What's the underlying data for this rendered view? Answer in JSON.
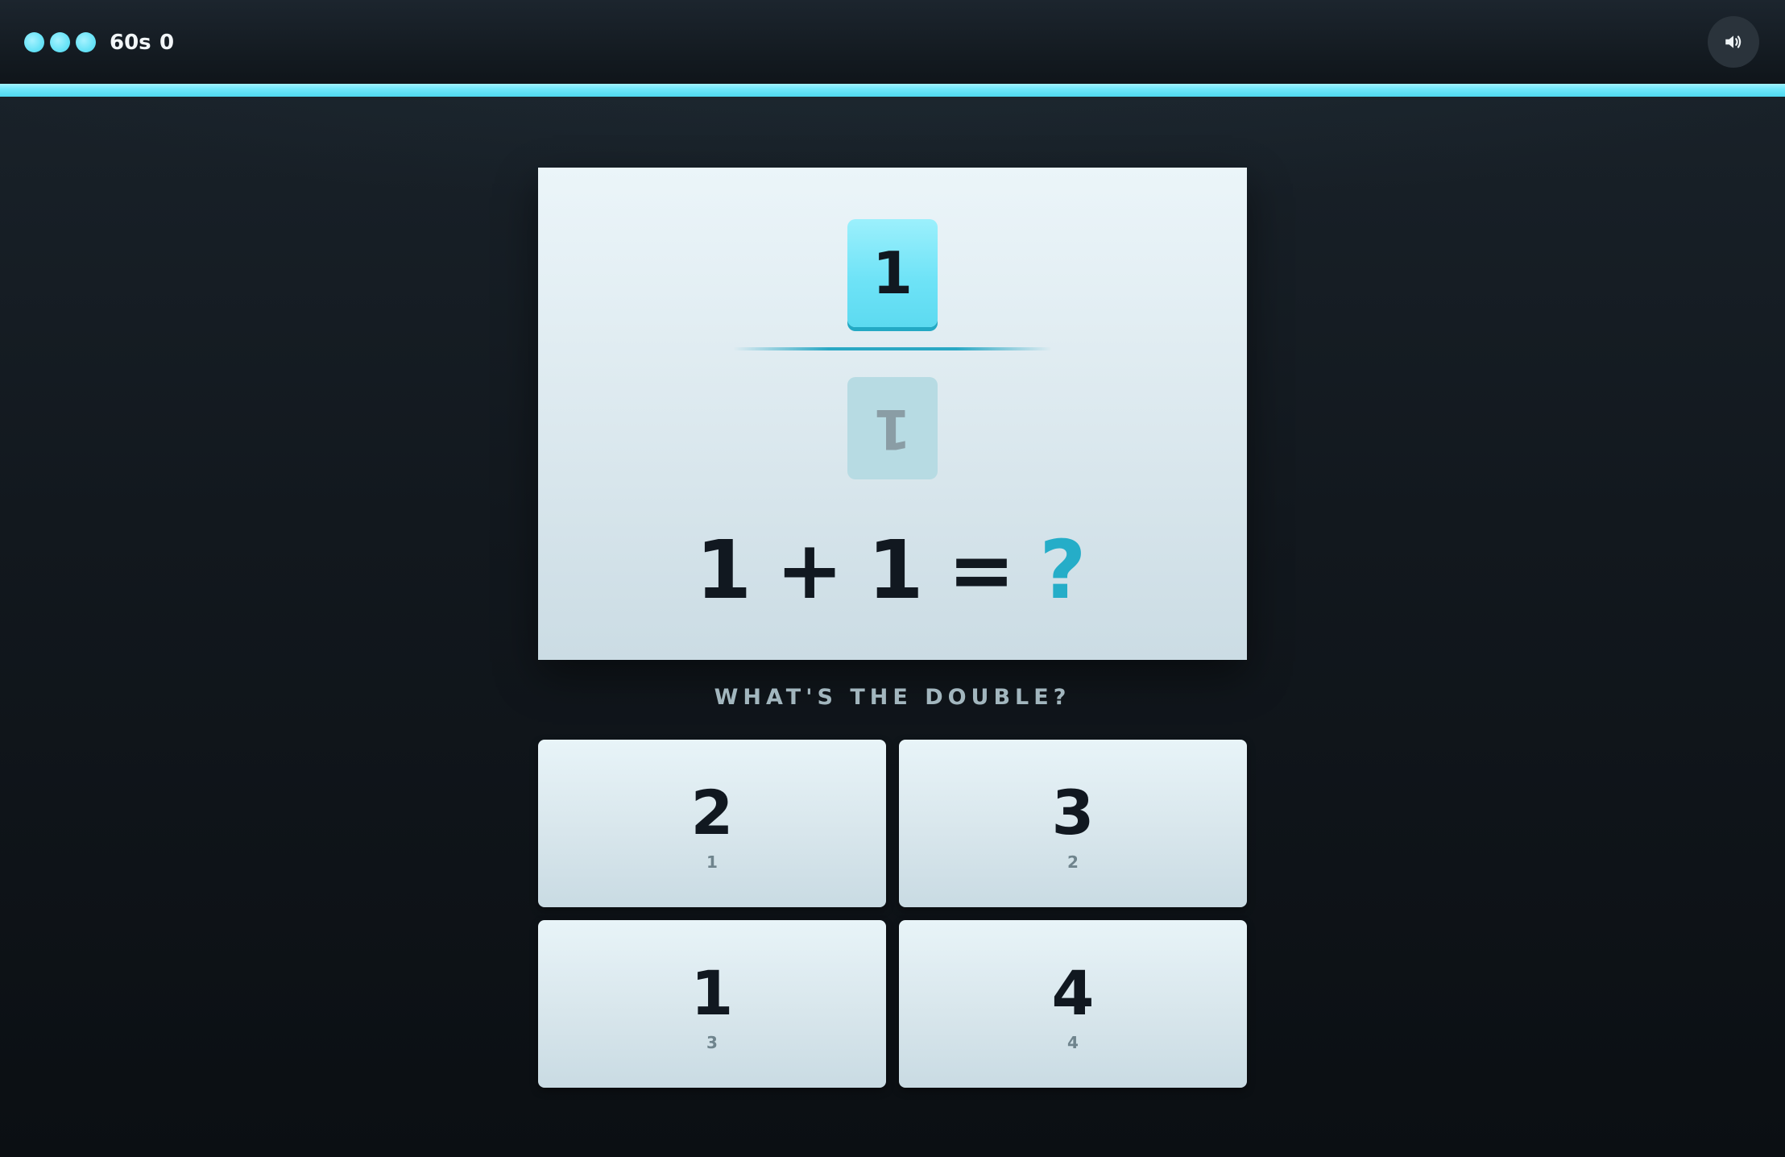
{
  "hud": {
    "lives": 3,
    "timer": "60s",
    "score": "0",
    "sound_icon": "speaker-volume-icon",
    "time_progress": 1.0,
    "accent": "#6fe3f7"
  },
  "problem": {
    "tile_top": "1",
    "tile_bottom": "1",
    "equation": {
      "left": "1",
      "operator": "+",
      "right": "1",
      "equals": "=",
      "unknown": "?"
    },
    "prompt": "WHAT'S THE DOUBLE?"
  },
  "answers": [
    {
      "value": "2",
      "key": "1"
    },
    {
      "value": "3",
      "key": "2"
    },
    {
      "value": "1",
      "key": "3"
    },
    {
      "value": "4",
      "key": "4"
    }
  ]
}
